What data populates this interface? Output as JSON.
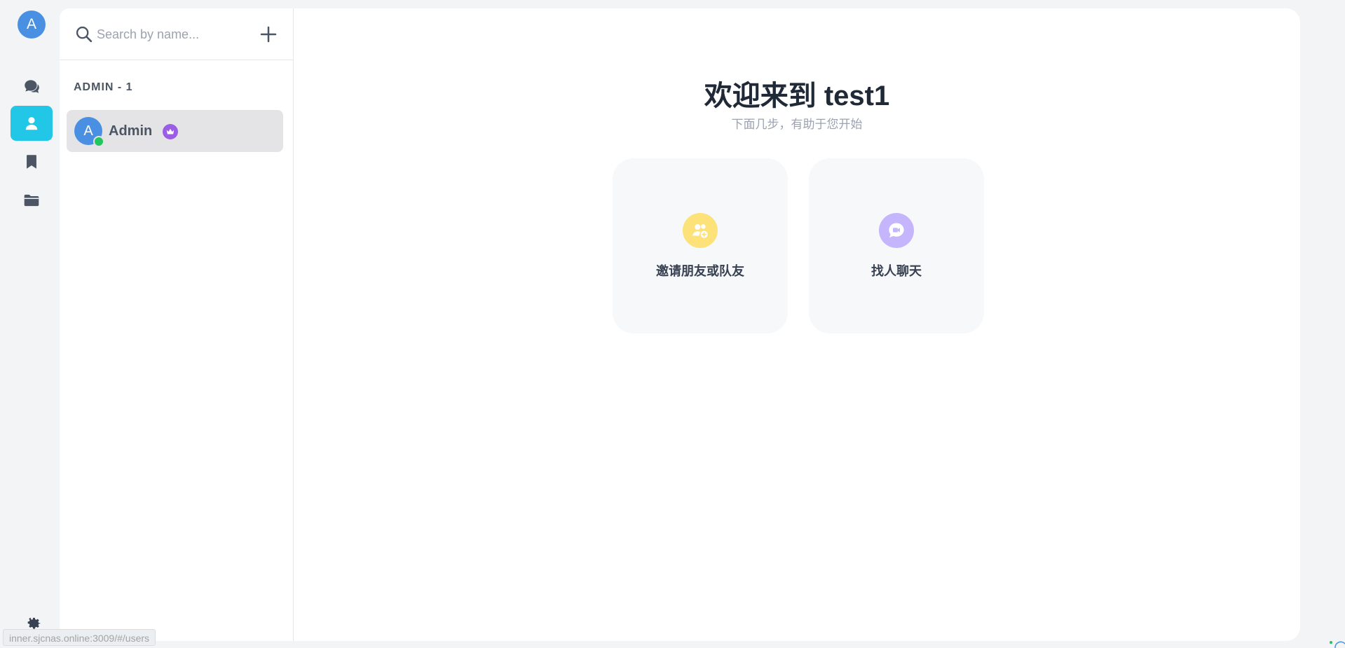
{
  "rail": {
    "avatar_letter": "A",
    "items": [
      {
        "name": "chats-icon",
        "active": false
      },
      {
        "name": "contacts-icon",
        "active": true
      },
      {
        "name": "bookmark-icon",
        "active": false
      },
      {
        "name": "folder-icon",
        "active": false
      }
    ],
    "settings_icon": "gear-icon"
  },
  "sidebar": {
    "search": {
      "placeholder": "Search by name...",
      "value": ""
    },
    "group_title": "ADMIN - 1",
    "users": [
      {
        "initial": "A",
        "name": "Admin",
        "status": "online",
        "badge": "crown-icon"
      }
    ]
  },
  "main": {
    "title": "欢迎来到 test1",
    "subtitle": "下面几步，有助于您开始",
    "cards": [
      {
        "label": "邀请朋友或队友",
        "icon": "invite-users-icon",
        "color": "#fde27a"
      },
      {
        "label": "找人聊天",
        "icon": "video-chat-icon",
        "color": "#c4b5fd"
      }
    ]
  },
  "status_bar": {
    "url": "inner.sjcnas.online:3009/#/users"
  },
  "colors": {
    "accent": "#22c7e8",
    "avatar": "#4a90e2",
    "online": "#22c55e",
    "badge": "#9b5de5"
  }
}
